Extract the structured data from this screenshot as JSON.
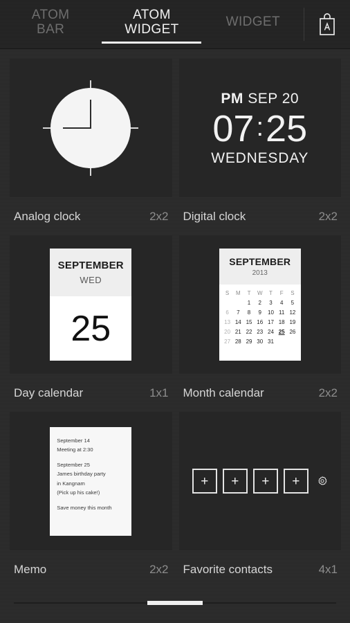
{
  "topbar": {
    "tabs": [
      {
        "label": "ATOM\nBAR",
        "active": false
      },
      {
        "label": "ATOM\nWIDGET",
        "active": true
      },
      {
        "label": "WIDGET",
        "active": false
      }
    ],
    "store_button": {
      "icon": "shopping-bag-icon",
      "letter": "A"
    }
  },
  "widgets": [
    {
      "name": "Analog clock",
      "size": "2x2"
    },
    {
      "name": "Digital clock",
      "size": "2x2"
    },
    {
      "name": "Day calendar",
      "size": "1x1"
    },
    {
      "name": "Month calendar",
      "size": "2x2"
    },
    {
      "name": "Memo",
      "size": "2x2"
    },
    {
      "name": "Favorite contacts",
      "size": "4x1"
    }
  ],
  "analog_clock": {
    "hour_hand_position": "12",
    "minute_hand_position": "9",
    "ticks": [
      "12",
      "3",
      "6",
      "9"
    ]
  },
  "digital_clock": {
    "ampm": "PM",
    "date": "SEP 20",
    "hour": "07",
    "colon": ":",
    "minute": "25",
    "weekday": "WEDNESDAY"
  },
  "day_calendar": {
    "month": "SEPTEMBER",
    "weekday": "WED",
    "day": "25"
  },
  "month_calendar": {
    "month": "SEPTEMBER",
    "year": "2013",
    "weekday_headers": [
      "S",
      "M",
      "T",
      "W",
      "T",
      "F",
      "S"
    ],
    "weeks": [
      [
        "",
        "",
        "1",
        "2",
        "3",
        "4",
        "5"
      ],
      [
        "6",
        "7",
        "8",
        "9",
        "10",
        "11",
        "12"
      ],
      [
        "13",
        "14",
        "15",
        "16",
        "17",
        "18",
        "19"
      ],
      [
        "20",
        "21",
        "22",
        "23",
        "24",
        "25",
        "26"
      ],
      [
        "27",
        "28",
        "29",
        "30",
        "31",
        "",
        ""
      ]
    ],
    "today": "25"
  },
  "memo": {
    "lines": [
      "September 14",
      "Meeting at 2:30",
      "",
      "September 25",
      "James birthday party",
      "in Kangnam",
      "(Pick up his cake!)",
      "",
      "Save money this month"
    ]
  },
  "favorite_contacts": {
    "slots": [
      "+",
      "+",
      "+",
      "+"
    ],
    "settings_icon": "gear-icon"
  },
  "scrollbar": {
    "page": "1"
  },
  "colors": {
    "background": "#2b2b2b",
    "topbar": "#232323",
    "tile": "#252525",
    "active_text": "#f2f2f2",
    "inactive_text": "#6e6e6e",
    "caption_text": "#d6d6d6",
    "size_text": "#8d8d8d",
    "card_white": "#ffffff",
    "card_header": "#eeeeee"
  }
}
